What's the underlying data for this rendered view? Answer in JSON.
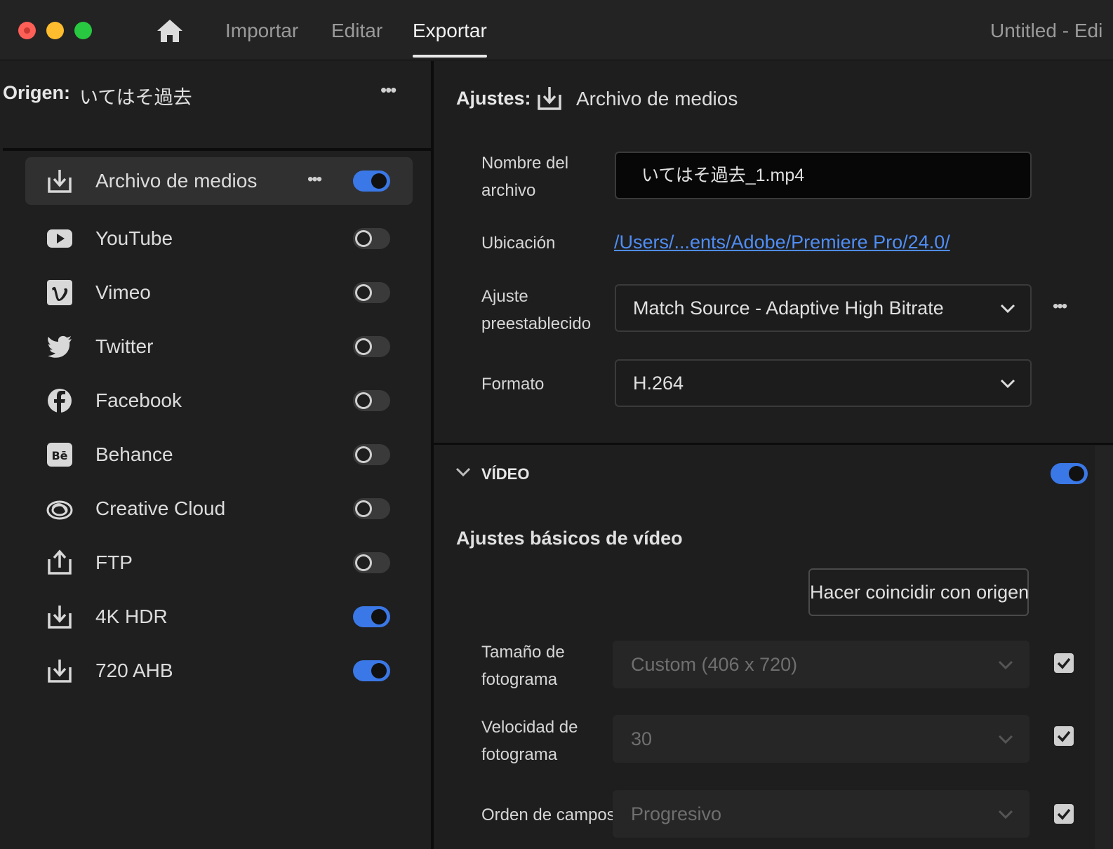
{
  "titlebar": {
    "tabs": [
      {
        "label": "Importar",
        "active": false
      },
      {
        "label": "Editar",
        "active": false
      },
      {
        "label": "Exportar",
        "active": true
      }
    ],
    "document_title": "Untitled - Edi"
  },
  "source": {
    "label": "Origen:",
    "value": "いてはそ過去",
    "more": "•••"
  },
  "destinations": [
    {
      "label": "Archivo de medios",
      "icon": "download-icon",
      "enabled": true,
      "selected": true,
      "more": "•••"
    },
    {
      "label": "YouTube",
      "icon": "youtube-icon",
      "enabled": false
    },
    {
      "label": "Vimeo",
      "icon": "vimeo-icon",
      "enabled": false
    },
    {
      "label": "Twitter",
      "icon": "twitter-icon",
      "enabled": false
    },
    {
      "label": "Facebook",
      "icon": "facebook-icon",
      "enabled": false
    },
    {
      "label": "Behance",
      "icon": "behance-icon",
      "enabled": false
    },
    {
      "label": "Creative Cloud",
      "icon": "creative-cloud-icon",
      "enabled": false
    },
    {
      "label": "FTP",
      "icon": "upload-icon",
      "enabled": false
    },
    {
      "label": "4K HDR",
      "icon": "download-icon",
      "enabled": true
    },
    {
      "label": "720 AHB",
      "icon": "download-icon",
      "enabled": true
    }
  ],
  "settings": {
    "label": "Ajustes:",
    "value": "Archivo de medios",
    "filename_label_1": "Nombre del",
    "filename_label_2": "archivo",
    "filename_value": "いてはそ過去_1.mp4",
    "location_label": "Ubicación",
    "location_value": "/Users/...ents/Adobe/Premiere Pro/24.0/",
    "preset_label_1": "Ajuste",
    "preset_label_2": "preestablecido",
    "preset_value": "Match Source - Adaptive High Bitrate",
    "preset_more": "•••",
    "format_label": "Formato",
    "format_value": "H.264"
  },
  "video": {
    "section_title": "VÍDEO",
    "enabled": true,
    "subhead": "Ajustes básicos de vídeo",
    "match_button": "Hacer coincidir con origen",
    "frame_size_label_1": "Tamaño de",
    "frame_size_label_2": "fotograma",
    "frame_size_value": "Custom (406 x 720)",
    "frame_size_checked": true,
    "frame_rate_label_1": "Velocidad de",
    "frame_rate_label_2": "fotograma",
    "frame_rate_value": "30",
    "frame_rate_checked": true,
    "field_order_label": "Orden de campos",
    "field_order_value": "Progresivo",
    "field_order_checked": true
  },
  "colors": {
    "accent": "#3b78e7",
    "link": "#4f8df5",
    "background": "#1e1e1e"
  }
}
